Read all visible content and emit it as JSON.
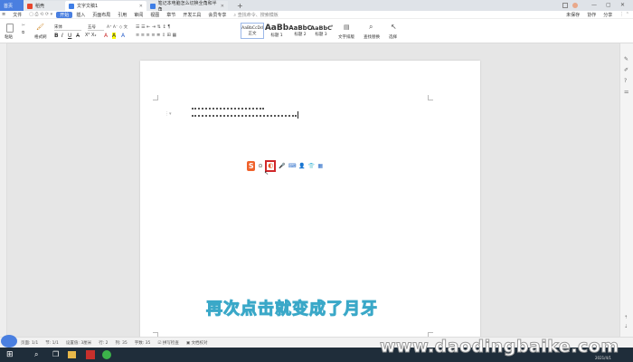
{
  "tabs": {
    "home": "首页",
    "daoke": "稻壳",
    "doc": "文字文稿1",
    "web": "笔记本电脑怎么切换全角和半角"
  },
  "menu": {
    "items": [
      "文件",
      "开始",
      "插入",
      "页面布局",
      "引用",
      "审阅",
      "视图",
      "章节",
      "开发工具",
      "会员专享"
    ],
    "active": "开始",
    "search": "查找命令、搜索模板",
    "right": [
      "未保存",
      "协作",
      "分享"
    ]
  },
  "ribbon": {
    "paste": "粘贴",
    "format_painter": "格式刷",
    "font": "宋体",
    "size": "五号",
    "styles": [
      {
        "preview": "AaBbCcDd",
        "label": "正文"
      },
      {
        "preview": "AaBb",
        "label": "标题 1"
      },
      {
        "preview": "AaBbC",
        "label": "标题 2"
      },
      {
        "preview": "AaBbC",
        "label": "标题 3"
      }
    ],
    "text_layout": "文字排版",
    "find_replace": "查找替换",
    "select": "选择"
  },
  "toolbar_popup": {
    "icons": [
      "sogou-logo-icon",
      "punctuation-icon",
      "fullwidth-toggle-icon",
      "mic-icon",
      "keyboard-icon",
      "user-icon",
      "skin-icon",
      "grid-icon"
    ]
  },
  "status": {
    "page": "页面: 1/1",
    "section": "节: 1/1",
    "settings": "设置值: 3厘米",
    "row": "行: 2",
    "col": "列: 35",
    "words": "字数: 35",
    "spell": "拼写检查",
    "proof": "文档校对"
  },
  "caption": "再次点击就变成了月牙",
  "watermark": "www.daodingbaike.com",
  "taskbar": {
    "date": "2021/4/1"
  },
  "colors": {
    "accent": "#4a7fe0",
    "highlight_box": "#d0282b",
    "caption": "#7fd3e8"
  }
}
